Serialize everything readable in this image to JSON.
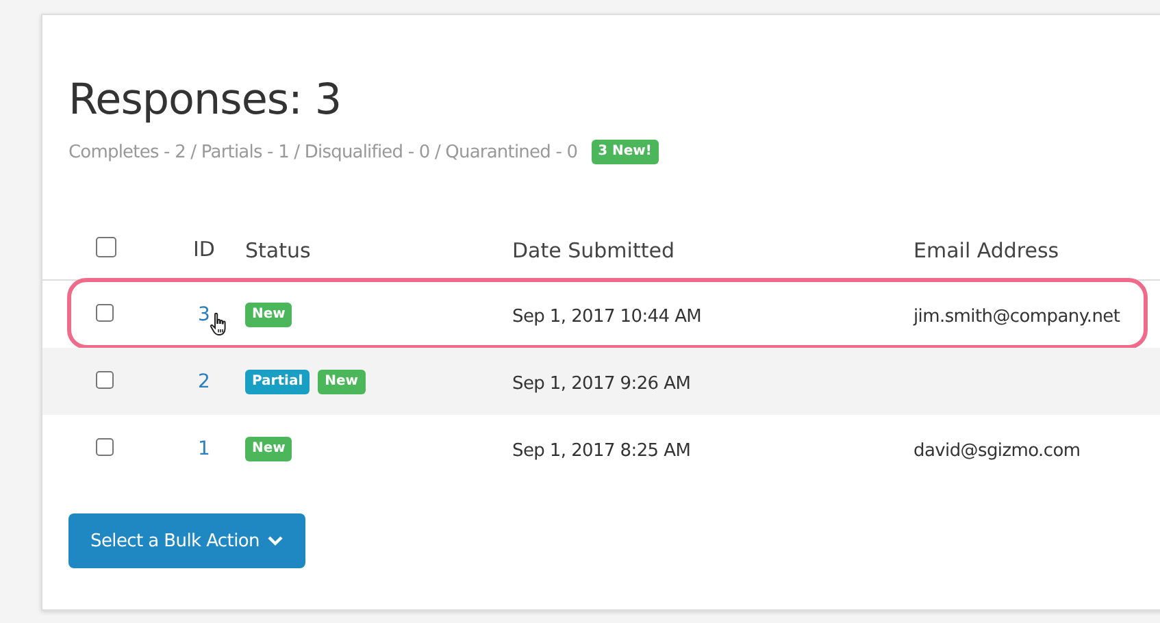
{
  "title": "Responses: 3",
  "summary": "Completes - 2 / Partials - 1 / Disqualified - 0 / Quarantined - 0",
  "new_badge": "3 New!",
  "table": {
    "select_all": {
      "checked": false
    },
    "columns": [
      "ID",
      "Status",
      "Date Submitted",
      "Email Address"
    ],
    "rows": [
      {
        "checked": false,
        "highlighted": true,
        "pointer": true,
        "id": "3",
        "badges": [
          {
            "kind": "new",
            "label": "New"
          }
        ],
        "date": "Sep 1, 2017 10:44 AM",
        "email": "jim.smith@company.net"
      },
      {
        "checked": false,
        "highlighted": false,
        "pointer": false,
        "id": "2",
        "badges": [
          {
            "kind": "partial",
            "label": "Partial"
          },
          {
            "kind": "new",
            "label": "New"
          }
        ],
        "date": "Sep 1, 2017 9:26 AM"
      },
      {
        "checked": false,
        "highlighted": false,
        "pointer": false,
        "id": "1",
        "badges": [
          {
            "kind": "new",
            "label": "New"
          }
        ],
        "date": "Sep 1, 2017 8:25 AM",
        "email": "david@sgizmo.com"
      }
    ]
  },
  "bulk_action_button": "Select a Bulk Action"
}
